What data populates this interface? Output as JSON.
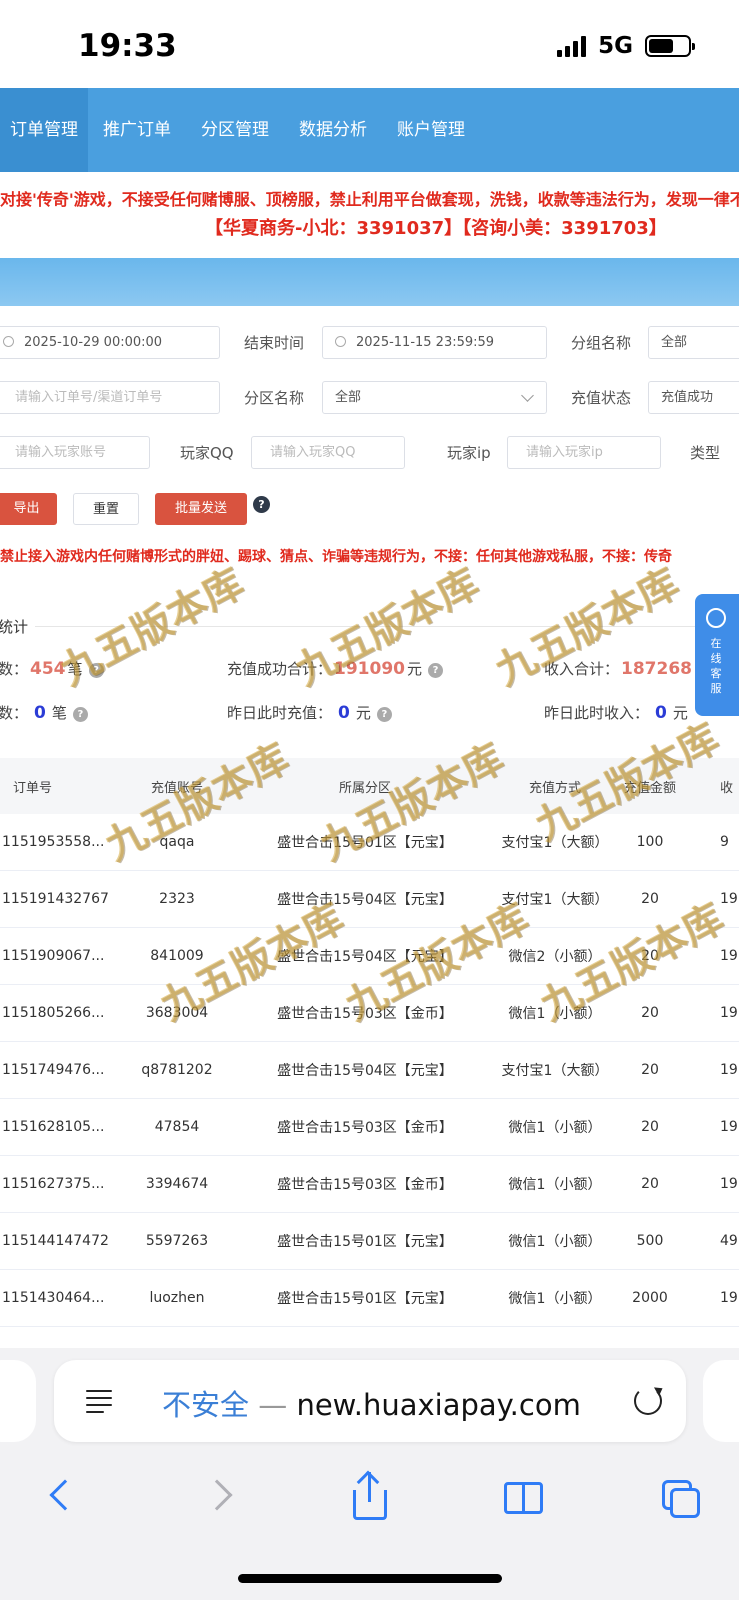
{
  "status_bar": {
    "time": "19:33",
    "network": "5G"
  },
  "nav": {
    "items": [
      "订单管理",
      "推广订单",
      "分区管理",
      "数据分析",
      "账户管理"
    ]
  },
  "notice": {
    "line1": "对接'传奇'游戏，不接受任何赌博服、顶榜服，禁止利用平台做套现，洗钱，收款等违法行为，发现一律不",
    "line2": "【华夏商务-小北：3391037】【咨询小美：3391703】"
  },
  "filters": {
    "start_time": "2025-10-29 00:00:00",
    "end_time_label": "结束时间",
    "end_time": "2025-11-15 23:59:59",
    "group_label": "分组名称",
    "group_value": "全部",
    "order_placeholder": "请输入订单号/渠道订单号",
    "zone_label": "分区名称",
    "zone_value": "全部",
    "status_label": "充值状态",
    "status_value": "充值成功",
    "player_account_placeholder": "请输入玩家账号",
    "qq_label": "玩家QQ",
    "qq_placeholder": "请输入玩家QQ",
    "ip_label": "玩家ip",
    "ip_placeholder": "请输入玩家ip",
    "type_label": "类型"
  },
  "buttons": {
    "export": "导出",
    "reset": "重置",
    "batch_send": "批量发送"
  },
  "warning2": "禁止接入游戏内任何赌博形式的胖妞、踢球、猜点、诈骗等违规行为，不接：任何其他游戏私服，不接：传奇",
  "stats": {
    "title": "统计",
    "count_label": "数：",
    "count_value": "454",
    "count_unit": "笔",
    "success_label": "充值成功合计：",
    "success_value": "191090",
    "success_unit": "元",
    "income_label": "收入合计：",
    "income_value": "187268",
    "y_count_label": "数：",
    "y_count_value": "0",
    "y_count_unit": "笔",
    "y_recharge_label": "昨日此时充值：",
    "y_recharge_value": "0",
    "y_recharge_unit": "元",
    "y_income_label": "昨日此时收入：",
    "y_income_value": "0",
    "y_income_unit": "元"
  },
  "service": {
    "label": "在线客服"
  },
  "table": {
    "headers": [
      "订单号",
      "充值账号",
      "所属分区",
      "充值方式",
      "充值金额",
      "收"
    ],
    "rows": [
      [
        "1151953558...",
        "qaqa",
        "盛世合击15号01区【元宝】",
        "支付宝1（大额）",
        "100",
        "9"
      ],
      [
        "115191432767",
        "2323",
        "盛世合击15号04区【元宝】",
        "支付宝1（大额）",
        "20",
        "19"
      ],
      [
        "1151909067...",
        "841009",
        "盛世合击15号04区【元宝】",
        "微信2（小额）",
        "20",
        "19"
      ],
      [
        "1151805266...",
        "3683004",
        "盛世合击15号03区【金币】",
        "微信1（小额）",
        "20",
        "19"
      ],
      [
        "1151749476...",
        "q8781202",
        "盛世合击15号04区【元宝】",
        "支付宝1（大额）",
        "20",
        "19"
      ],
      [
        "1151628105...",
        "47854",
        "盛世合击15号03区【金币】",
        "微信1（小额）",
        "20",
        "19"
      ],
      [
        "1151627375...",
        "3394674",
        "盛世合击15号03区【金币】",
        "微信1（小额）",
        "20",
        "19"
      ],
      [
        "115144147472",
        "5597263",
        "盛世合击15号01区【元宝】",
        "微信1（小额）",
        "500",
        "49"
      ],
      [
        "1151430464...",
        "luozhen",
        "盛世合击15号01区【元宝】",
        "微信1（小额）",
        "2000",
        "19"
      ]
    ]
  },
  "watermark": "九五版本库",
  "browser": {
    "insecure": "不安全",
    "dash": "—",
    "url": "new.huaxiapay.com"
  }
}
